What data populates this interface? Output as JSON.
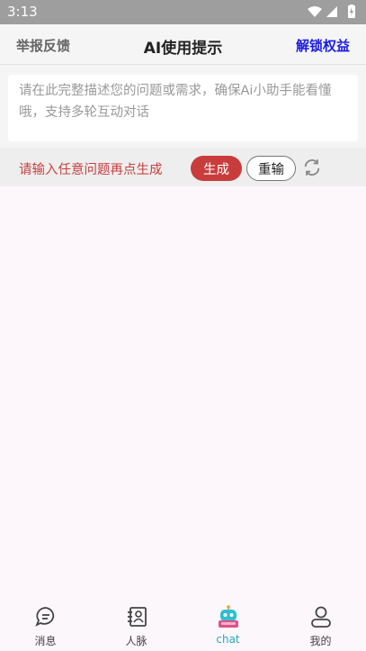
{
  "status": {
    "time": "3:13"
  },
  "header": {
    "report": "举报反馈",
    "title": "AI使用提示",
    "unlock": "解锁权益"
  },
  "input": {
    "placeholder": "请在此完整描述您的问题或需求，确保Ai小助手能看懂哦，支持多轮互动对话"
  },
  "actions": {
    "hint": "请输入任意问题再点生成",
    "generate": "生成",
    "reinput": "重输"
  },
  "tabs": [
    {
      "label": "消息",
      "icon": "message-icon"
    },
    {
      "label": "人脉",
      "icon": "contacts-icon"
    },
    {
      "label": "chat",
      "icon": "robot-icon"
    },
    {
      "label": "我的",
      "icon": "profile-icon"
    }
  ],
  "colors": {
    "accent_red": "#c93c3c",
    "link_blue": "#1a1ae6",
    "active_tab": "#2aa7b8"
  }
}
